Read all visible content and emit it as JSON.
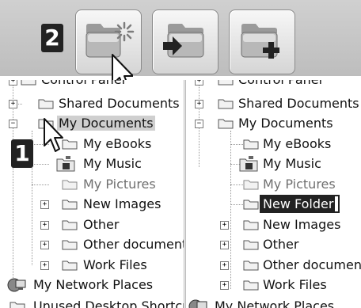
{
  "toolbar": {
    "step2_label": "2",
    "buttons": [
      {
        "name": "new-folder-button",
        "icon": "folder-sparkle-icon"
      },
      {
        "name": "move-to-folder-button",
        "icon": "folder-arrow-icon"
      },
      {
        "name": "add-folder-button",
        "icon": "folder-plus-icon"
      }
    ]
  },
  "step1_label": "1",
  "left_tree": {
    "top_partial": "Control Panel",
    "shared": "Shared Documents",
    "mydocs": "My Documents",
    "children": [
      "My eBooks",
      "My Music",
      "My Pictures",
      "New Images",
      "Other",
      "Other documents",
      "Work Files"
    ],
    "network": "My Network Places",
    "bottom_partial": "Unused Desktop Shortcuts"
  },
  "right_tree": {
    "top_partial": "Control Panel",
    "shared": "Shared Documents",
    "mydocs": "My Documents",
    "children": [
      "My eBooks",
      "My Music",
      "My Pictures",
      "New Folder",
      "New Images",
      "Other",
      "Other documents",
      "Work Files"
    ],
    "bottom_partial": "My Network Places"
  }
}
